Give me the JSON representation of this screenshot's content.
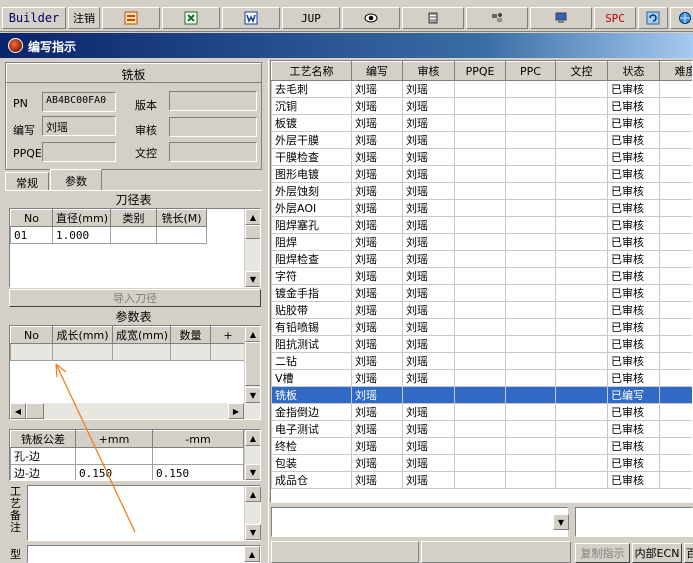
{
  "toolbar": {
    "builder": "Builder",
    "logout": "注销",
    "jup": "JUP",
    "spc": "SPC",
    "icons": [
      "form-icon",
      "excel-icon",
      "word-icon",
      "eye-icon",
      "database-icon",
      "tools-icon",
      "computer-icon",
      "refresh-icon",
      "globe-icon"
    ]
  },
  "window": {
    "title": "编写指示"
  },
  "board": {
    "title": "铣板",
    "pn_label": "PN",
    "pn_value": "AB4BC00FA0",
    "version_label": "版本",
    "version_value": "",
    "author_label": "编写",
    "author_value": "刘瑶",
    "review_label": "审核",
    "review_value": "",
    "ppqe_label": "PPQE",
    "ppqe_value": "",
    "doc_label": "文控",
    "doc_value": ""
  },
  "tabs": {
    "general": "常规",
    "params": "参数"
  },
  "tool_table": {
    "title": "刀径表",
    "columns": [
      "No",
      "直径(mm)",
      "类别",
      "铣长(M)"
    ],
    "rows": [
      [
        "01",
        "1.000",
        "",
        ""
      ]
    ],
    "import_button": "导入刀径"
  },
  "param_table": {
    "title": "参数表",
    "columns": [
      "No",
      "成长(mm)",
      "成宽(mm)",
      "数量",
      "+"
    ]
  },
  "tolerance_table": {
    "columns": [
      "铣板公差",
      "+mm",
      "-mm"
    ],
    "rows": [
      [
        "孔-边",
        "",
        ""
      ],
      [
        "边-边",
        "0.150",
        "0.150"
      ]
    ]
  },
  "remarks": {
    "label": "工艺备注",
    "label2": "型"
  },
  "process": {
    "columns": [
      "工艺名称",
      "编写",
      "审核",
      "PPQE",
      "PPC",
      "文控",
      "状态",
      "难度"
    ],
    "rows": [
      [
        "去毛刺",
        "刘瑶",
        "刘瑶",
        "",
        "",
        "",
        "已审核",
        ""
      ],
      [
        "沉铜",
        "刘瑶",
        "刘瑶",
        "",
        "",
        "",
        "已审核",
        ""
      ],
      [
        "板镀",
        "刘瑶",
        "刘瑶",
        "",
        "",
        "",
        "已审核",
        ""
      ],
      [
        "外层干膜",
        "刘瑶",
        "刘瑶",
        "",
        "",
        "",
        "已审核",
        ""
      ],
      [
        "干膜检查",
        "刘瑶",
        "刘瑶",
        "",
        "",
        "",
        "已审核",
        ""
      ],
      [
        "图形电镀",
        "刘瑶",
        "刘瑶",
        "",
        "",
        "",
        "已审核",
        ""
      ],
      [
        "外层蚀刻",
        "刘瑶",
        "刘瑶",
        "",
        "",
        "",
        "已审核",
        ""
      ],
      [
        "外层AOI",
        "刘瑶",
        "刘瑶",
        "",
        "",
        "",
        "已审核",
        ""
      ],
      [
        "阻焊塞孔",
        "刘瑶",
        "刘瑶",
        "",
        "",
        "",
        "已审核",
        ""
      ],
      [
        "阻焊",
        "刘瑶",
        "刘瑶",
        "",
        "",
        "",
        "已审核",
        ""
      ],
      [
        "阻焊检查",
        "刘瑶",
        "刘瑶",
        "",
        "",
        "",
        "已审核",
        ""
      ],
      [
        "字符",
        "刘瑶",
        "刘瑶",
        "",
        "",
        "",
        "已审核",
        ""
      ],
      [
        "镀金手指",
        "刘瑶",
        "刘瑶",
        "",
        "",
        "",
        "已审核",
        ""
      ],
      [
        "贴胶带",
        "刘瑶",
        "刘瑶",
        "",
        "",
        "",
        "已审核",
        ""
      ],
      [
        "有铅喷锡",
        "刘瑶",
        "刘瑶",
        "",
        "",
        "",
        "已审核",
        ""
      ],
      [
        "阻抗测试",
        "刘瑶",
        "刘瑶",
        "",
        "",
        "",
        "已审核",
        ""
      ],
      [
        "二钻",
        "刘瑶",
        "刘瑶",
        "",
        "",
        "",
        "已审核",
        ""
      ],
      [
        "V槽",
        "刘瑶",
        "刘瑶",
        "",
        "",
        "",
        "已审核",
        ""
      ],
      [
        "铣板",
        "刘瑶",
        "",
        "",
        "",
        "",
        "已编写",
        ""
      ],
      [
        "金指倒边",
        "刘瑶",
        "刘瑶",
        "",
        "",
        "",
        "已审核",
        ""
      ],
      [
        "电子测试",
        "刘瑶",
        "刘瑶",
        "",
        "",
        "",
        "已审核",
        ""
      ],
      [
        "终检",
        "刘瑶",
        "刘瑶",
        "",
        "",
        "",
        "已审核",
        ""
      ],
      [
        "包装",
        "刘瑶",
        "刘瑶",
        "",
        "",
        "",
        "已审核",
        ""
      ],
      [
        "成品仓",
        "刘瑶",
        "刘瑶",
        "",
        "",
        "",
        "已审核",
        ""
      ]
    ],
    "selected_index": 18
  },
  "bottom_buttons": {
    "copy": "复制指示",
    "internal_ecn": "内部ECN",
    "cut_char": "百"
  }
}
